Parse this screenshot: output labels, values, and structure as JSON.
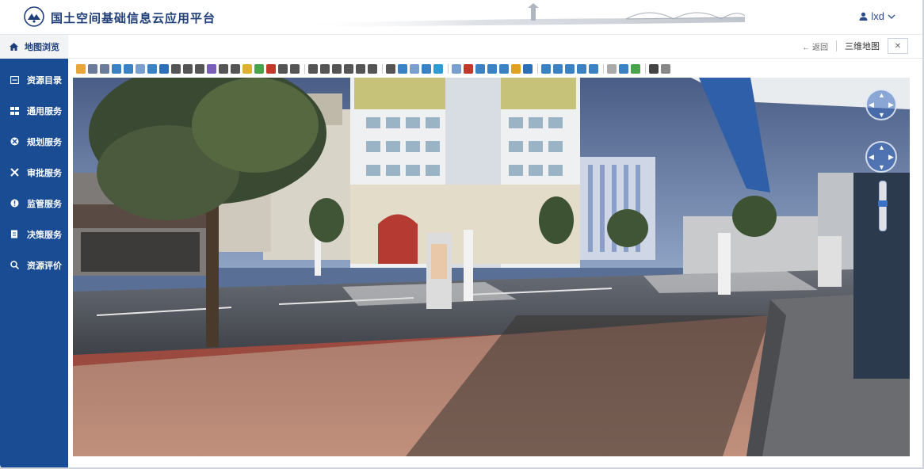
{
  "app": {
    "title": "国土空间基础信息云应用平台",
    "user": "lxd"
  },
  "tabbar": {
    "active_tab": "地图浏览",
    "back_label": "← 返回",
    "map_mode": "三维地图",
    "close_label": "✕"
  },
  "sidebar": {
    "items": [
      {
        "label": "资源目录",
        "icon": "catalog-icon"
      },
      {
        "label": "通用服务",
        "icon": "grid-icon"
      },
      {
        "label": "规划服务",
        "icon": "planning-icon"
      },
      {
        "label": "审批服务",
        "icon": "approval-icon"
      },
      {
        "label": "监管服务",
        "icon": "alert-icon"
      },
      {
        "label": "决策服务",
        "icon": "decision-icon"
      },
      {
        "label": "资源评价",
        "icon": "evaluate-icon"
      }
    ]
  },
  "toolbar": {
    "groups": [
      [
        "#e8a53a",
        "#6a7c9a",
        "#6a7c9a",
        "#3b82c4",
        "#3b82c4",
        "#7aa0d0",
        "#3b82c4",
        "#2d6fb6",
        "#555",
        "#555",
        "#555",
        "#7a5fb8",
        "#555",
        "#555",
        "#e0b030",
        "#4aa34a",
        "#c0392b",
        "#555",
        "#555"
      ],
      [
        "#555",
        "#555",
        "#555",
        "#555",
        "#555",
        "#555"
      ],
      [
        "#555",
        "#3b82c4",
        "#7aa0d0",
        "#3b82c4",
        "#2d9bd6"
      ],
      [
        "#7aa0d0",
        "#c0392b",
        "#3b82c4",
        "#3b82c4",
        "#3b82c4",
        "#e0a020",
        "#2d6fb6"
      ],
      [
        "#3b82c4",
        "#3b82c4",
        "#3b82c4",
        "#3b82c4",
        "#3b82c4"
      ],
      [
        "#aaa",
        "#3b82c4",
        "#4aa34a"
      ],
      [
        "#444",
        "#888"
      ]
    ]
  },
  "colors": {
    "sidebar_bg": "#1a4c93",
    "brand_text": "#1f3f7a",
    "nav_control": "#3c6ebe"
  }
}
